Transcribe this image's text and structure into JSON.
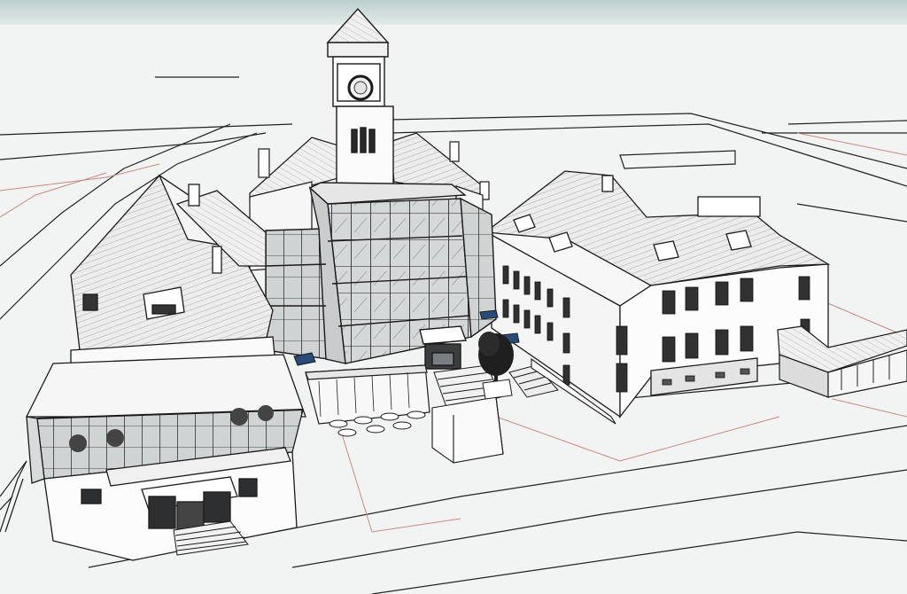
{
  "scene": {
    "kind": "architectural sketch render",
    "style": "black line drawing on white, light grey shading",
    "colors": {
      "sky_top": "#bcd0cf",
      "sky_bottom": "#f3f4f4",
      "ground": "#f1f2f2",
      "roof": "#e9eaea",
      "wall": "#fbfbfb",
      "glass": "#cfd3d4",
      "window": "#3a3c3e",
      "line": "#1b1b1b",
      "plot_line": "#c98a84",
      "tree": "#1f1f1f"
    },
    "elements": [
      "clock-tower",
      "glass-atrium",
      "left-wing-with-glass-pavilion",
      "right-wing",
      "far-right-annex",
      "entrance-stairs",
      "outdoor-terrace-tables",
      "tree",
      "roads"
    ]
  }
}
